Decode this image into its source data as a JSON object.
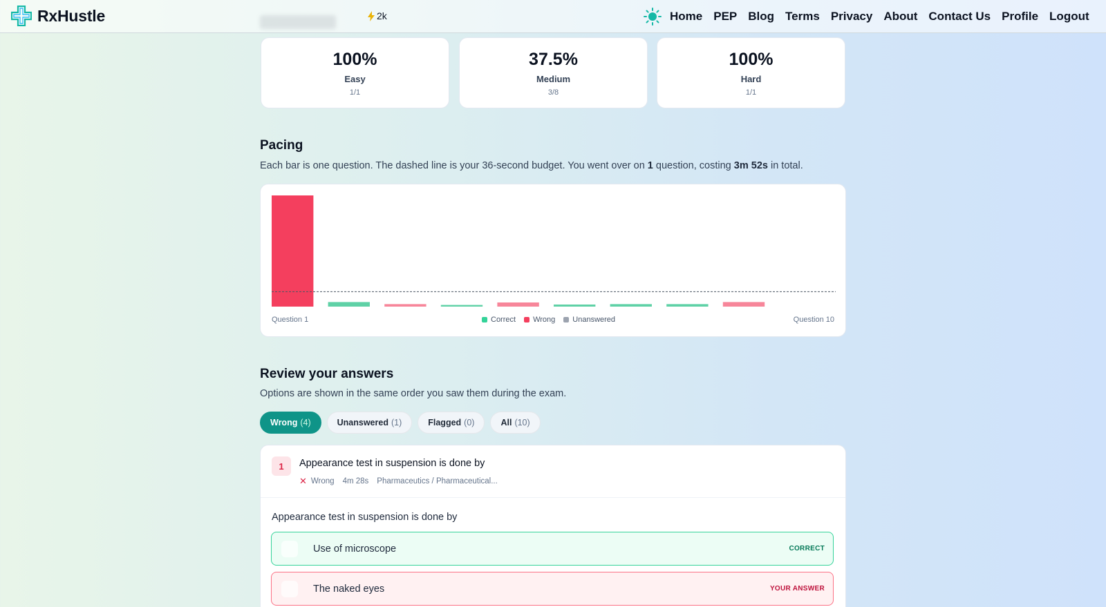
{
  "header": {
    "brand": "RxHustle",
    "streak": "2k",
    "nav": [
      "Home",
      "PEP",
      "Blog",
      "Terms",
      "Privacy",
      "About",
      "Contact Us",
      "Profile",
      "Logout"
    ]
  },
  "stats": [
    {
      "value": "100%",
      "label": "Easy",
      "count": "1/1"
    },
    {
      "value": "37.5%",
      "label": "Medium",
      "count": "3/8"
    },
    {
      "value": "100%",
      "label": "Hard",
      "count": "1/1"
    }
  ],
  "pacing": {
    "title": "Pacing",
    "desc_pre": "Each bar is one question. The dashed line is your 36-second budget. You went over on ",
    "desc_count": "1",
    "desc_mid": " question, costing ",
    "desc_cost": "3m 52s",
    "desc_post": " in total."
  },
  "chart_data": {
    "type": "bar",
    "categories": [
      "Question 1",
      "Question 2",
      "Question 3",
      "Question 4",
      "Question 5",
      "Question 6",
      "Question 7",
      "Question 8",
      "Question 9",
      "Question 10"
    ],
    "values": [
      268,
      11,
      6,
      4,
      10,
      5,
      6,
      6,
      11,
      0
    ],
    "statuses": [
      "wrong",
      "correct",
      "wrong",
      "correct",
      "wrong",
      "correct",
      "correct",
      "correct",
      "wrong",
      "unanswered"
    ],
    "budget": 36,
    "ylim": [
      0,
      268
    ],
    "x_start_label": "Question 1",
    "x_end_label": "Question 10",
    "legend": [
      {
        "name": "Correct",
        "color": "#34d399"
      },
      {
        "name": "Wrong",
        "color": "#f43f5e"
      },
      {
        "name": "Unanswered",
        "color": "#9ca3af"
      }
    ],
    "colors": {
      "correct": "#5fd1a6",
      "wrong": "#f7869a",
      "wrong_over": "#f43f5e",
      "unanswered": "#9ca3af"
    }
  },
  "review": {
    "title": "Review your answers",
    "desc": "Options are shown in the same order you saw them during the exam.",
    "filters": [
      {
        "label": "Wrong",
        "count": "(4)"
      },
      {
        "label": "Unanswered",
        "count": "(1)"
      },
      {
        "label": "Flagged",
        "count": "(0)"
      },
      {
        "label": "All",
        "count": "(10)"
      }
    ],
    "question": {
      "number": "1",
      "title": "Appearance test in suspension is done by",
      "status": "Wrong",
      "time": "4m 28s",
      "topic": "Pharmaceutics / Pharmaceutical...",
      "body": "Appearance test in suspension is done by",
      "options": [
        {
          "text": "Use of microscope",
          "tag": "CORRECT"
        },
        {
          "text": "The naked eyes",
          "tag": "YOUR ANSWER"
        }
      ]
    }
  }
}
